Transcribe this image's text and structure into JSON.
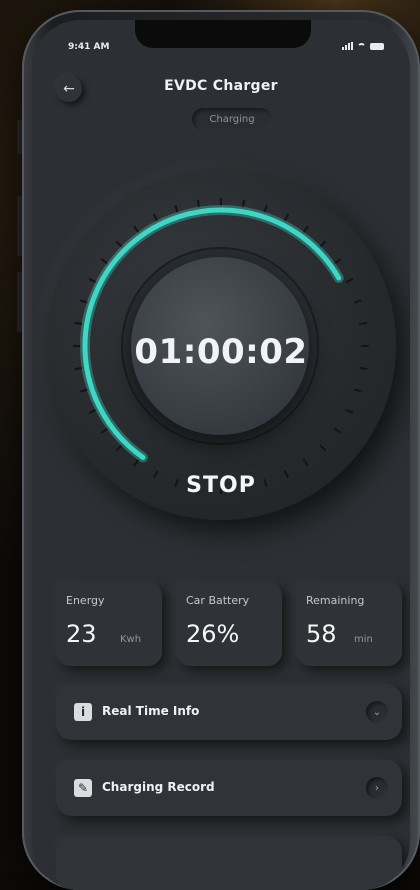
{
  "status_bar": {
    "time": "9:41 AM"
  },
  "header": {
    "title": "EVDC Charger",
    "status_chip": "Charging",
    "back_icon": "back-arrow-icon"
  },
  "dial": {
    "timer": "01:00:02",
    "stop_label": "STOP",
    "accent_color": "#3fd6c6",
    "arc_start_deg": 215,
    "arc_end_deg": 60,
    "tick_count": 40
  },
  "stats": [
    {
      "label": "Energy",
      "value": "23",
      "unit": "Kwh"
    },
    {
      "label": "Car Battery",
      "value": "26%",
      "unit": ""
    },
    {
      "label": "Remaining",
      "value": "58",
      "unit": "min"
    }
  ],
  "menu": [
    {
      "label": "Real Time Info",
      "icon": "info-icon",
      "chevron": "chevron-down-icon"
    },
    {
      "label": "Charging Record",
      "icon": "document-edit-icon",
      "chevron": "chevron-right-icon"
    }
  ]
}
